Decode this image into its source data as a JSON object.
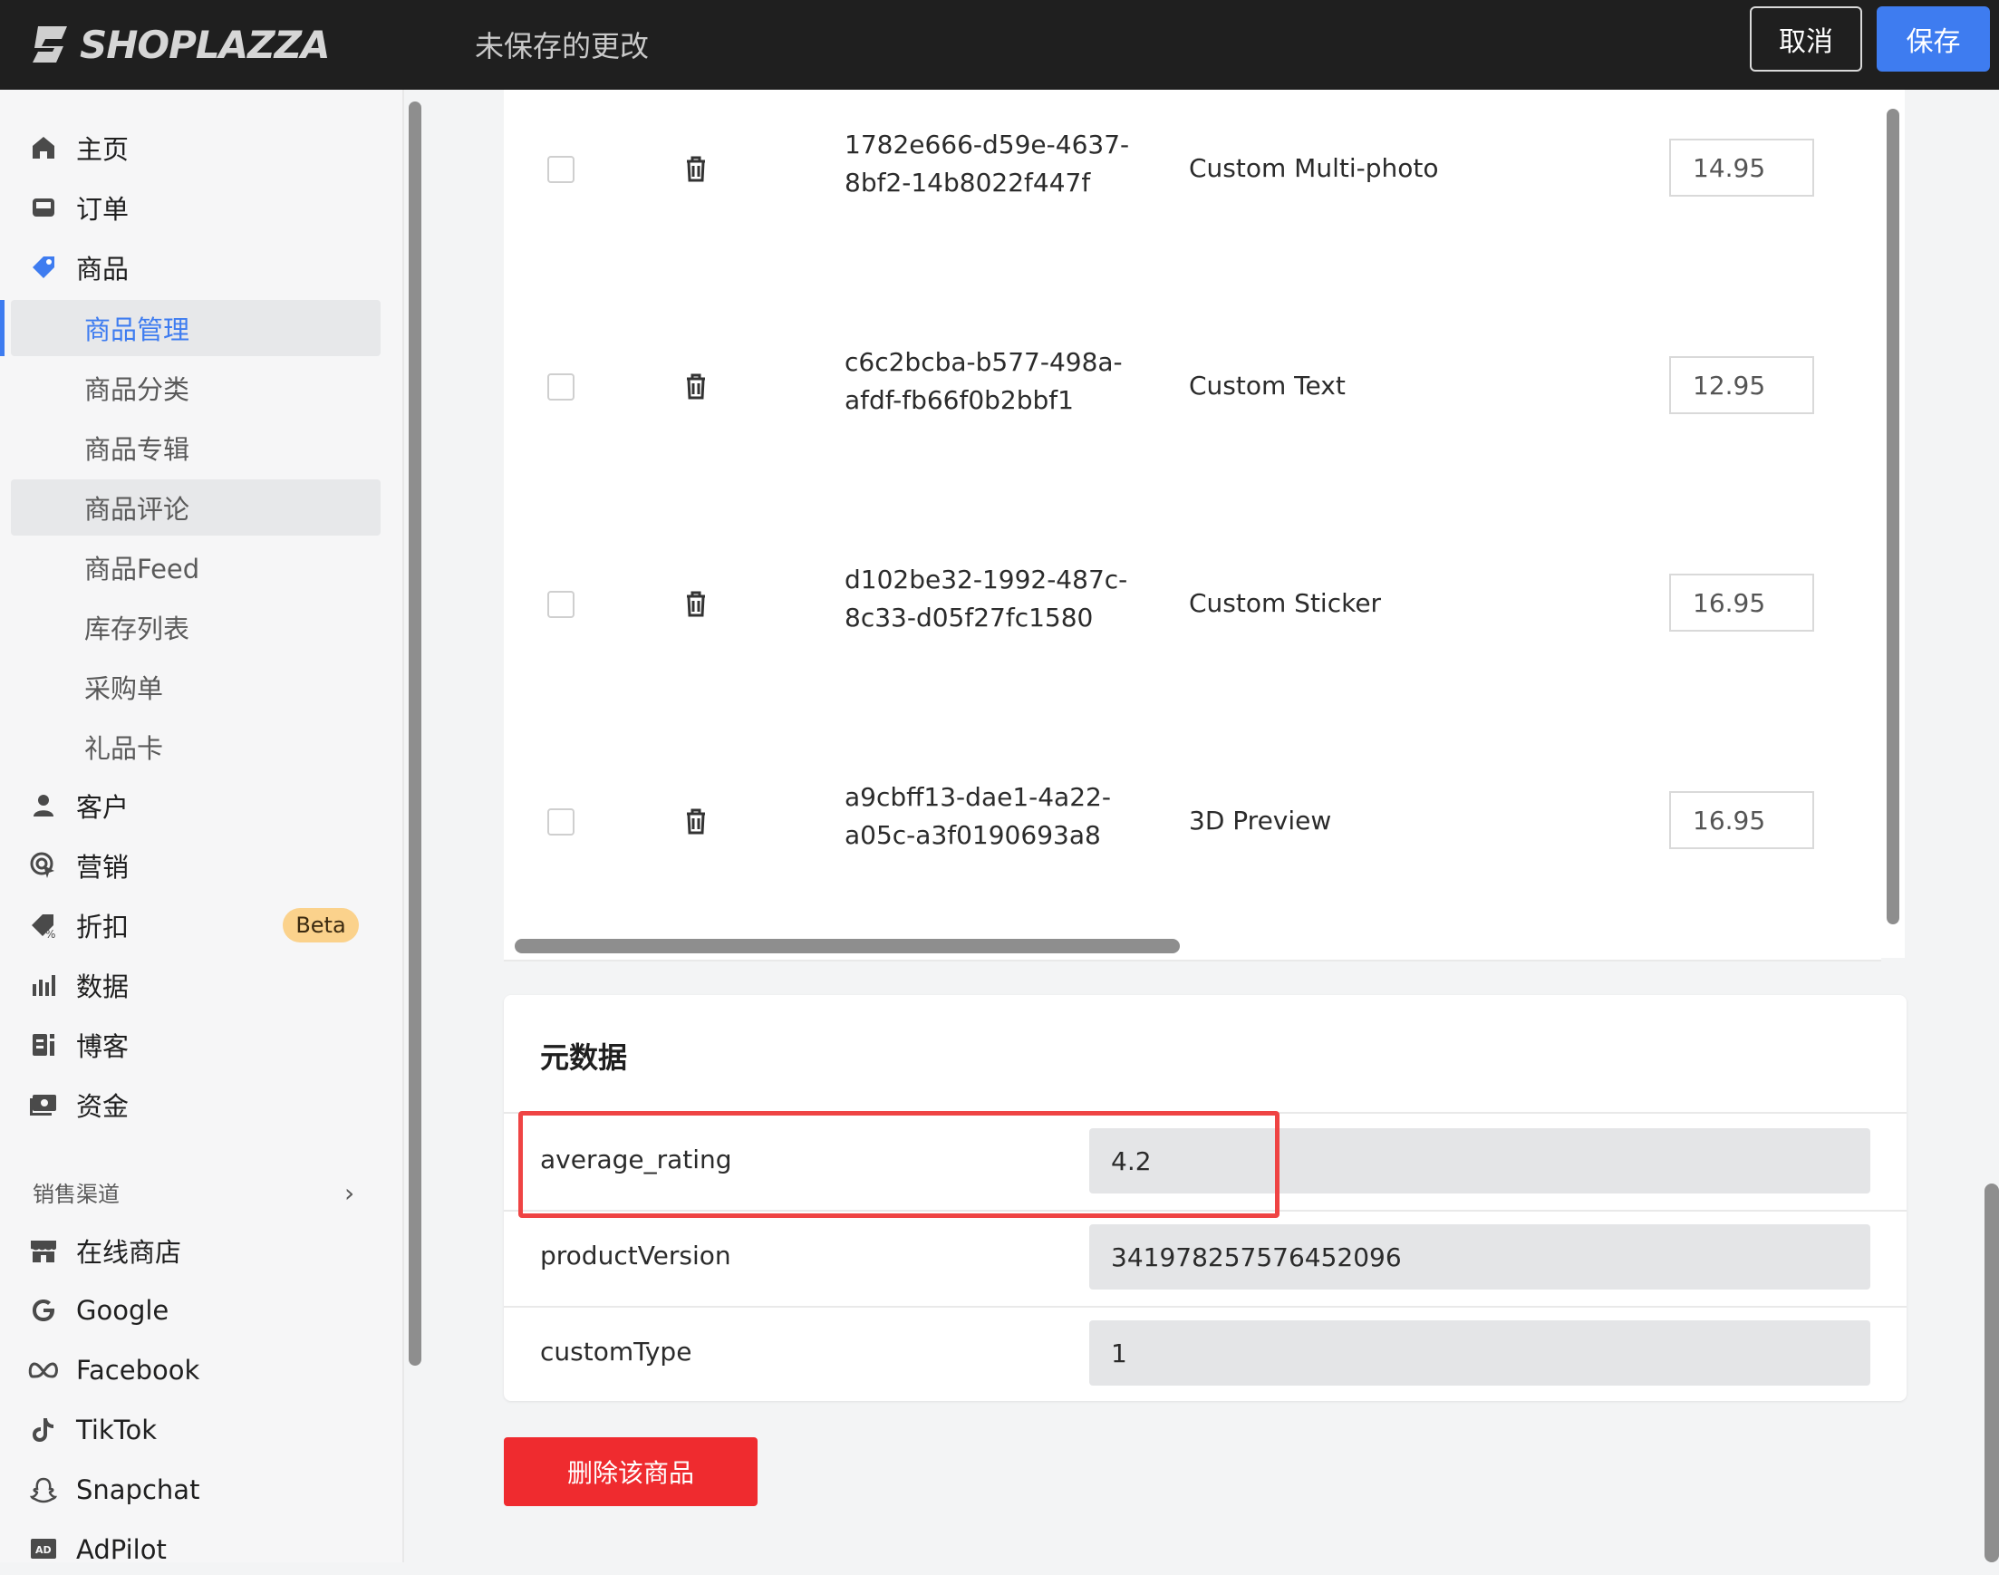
{
  "header": {
    "logo_text": "SHOPLAZZA",
    "unsaved": "未保存的更改",
    "cancel_label": "取消",
    "save_label": "保存"
  },
  "sidebar": {
    "items": [
      {
        "label": "主页",
        "icon": "home-icon"
      },
      {
        "label": "订单",
        "icon": "inbox-icon"
      },
      {
        "label": "商品",
        "icon": "tag-icon"
      },
      {
        "label": "客户",
        "icon": "user-icon"
      },
      {
        "label": "营销",
        "icon": "target-icon"
      },
      {
        "label": "折扣",
        "icon": "discount-icon"
      },
      {
        "label": "数据",
        "icon": "bar-chart-icon"
      },
      {
        "label": "博客",
        "icon": "blog-icon"
      },
      {
        "label": "资金",
        "icon": "wallet-icon"
      }
    ],
    "sub_items": [
      "商品管理",
      "商品分类",
      "商品专辑",
      "商品评论",
      "商品Feed",
      "库存列表",
      "采购单",
      "礼品卡"
    ],
    "beta_badge": "Beta",
    "section_label": "销售渠道",
    "channels": [
      {
        "label": "在线商店",
        "icon": "store-icon"
      },
      {
        "label": "Google",
        "icon": "google-icon"
      },
      {
        "label": "Facebook",
        "icon": "meta-icon"
      },
      {
        "label": "TikTok",
        "icon": "tiktok-icon"
      },
      {
        "label": "Snapchat",
        "icon": "snapchat-icon"
      },
      {
        "label": "AdPilot",
        "icon": "ad-icon"
      }
    ]
  },
  "table": {
    "rows": [
      {
        "uuid_line1": "1782e666-d59e-4637-",
        "uuid_line2": "8bf2-14b8022f447f",
        "name": "Custom Multi-photo",
        "price": "14.95"
      },
      {
        "uuid_line1": "c6c2bcba-b577-498a-",
        "uuid_line2": "afdf-fb66f0b2bbf1",
        "name": "Custom Text",
        "price": "12.95"
      },
      {
        "uuid_line1": "d102be32-1992-487c-",
        "uuid_line2": "8c33-d05f27fc1580",
        "name": "Custom Sticker",
        "price": "16.95"
      },
      {
        "uuid_line1": "a9cbff13-dae1-4a22-",
        "uuid_line2": "a05c-a3f0190693a8",
        "name": "3D Preview",
        "price": "16.95"
      }
    ]
  },
  "metadata": {
    "title": "元数据",
    "rows": [
      {
        "key": "average_rating",
        "value": "4.2"
      },
      {
        "key": "productVersion",
        "value": "341978257576452096"
      },
      {
        "key": "customType",
        "value": "1"
      }
    ]
  },
  "actions": {
    "delete_label": "删除该商品"
  },
  "colors": {
    "accent": "#3e7cf0",
    "danger": "#ef2b2f",
    "highlight": "#ef4444",
    "topbar": "#1f1f1f"
  }
}
